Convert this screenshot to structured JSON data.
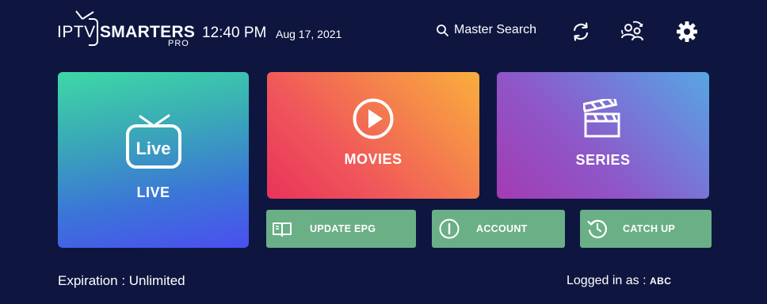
{
  "header": {
    "logo": {
      "iptv": "IPTV",
      "smarters": "SMARTERS",
      "pro": "PRO"
    },
    "time": "12:40 PM",
    "date": "Aug 17, 2021",
    "search_label": "Master Search"
  },
  "tiles": {
    "live": {
      "label": "LIVE",
      "icon_text": "Live"
    },
    "movies": {
      "label": "MOVIES"
    },
    "series": {
      "label": "SERIES"
    }
  },
  "buttons": {
    "update_epg": "UPDATE EPG",
    "account": "ACCOUNT",
    "catch_up": "CATCH UP"
  },
  "footer": {
    "expiration": "Expiration : Unlimited",
    "logged_in_prefix": "Logged in as : ",
    "username": "ABC"
  },
  "colors": {
    "background": "#0e1640",
    "button_green": "#6aaf86"
  },
  "icons": [
    "search-icon",
    "refresh-icon",
    "switch-user-icon",
    "gear-icon",
    "tv-icon",
    "play-icon",
    "clapperboard-icon",
    "book-icon",
    "info-icon",
    "history-icon"
  ]
}
